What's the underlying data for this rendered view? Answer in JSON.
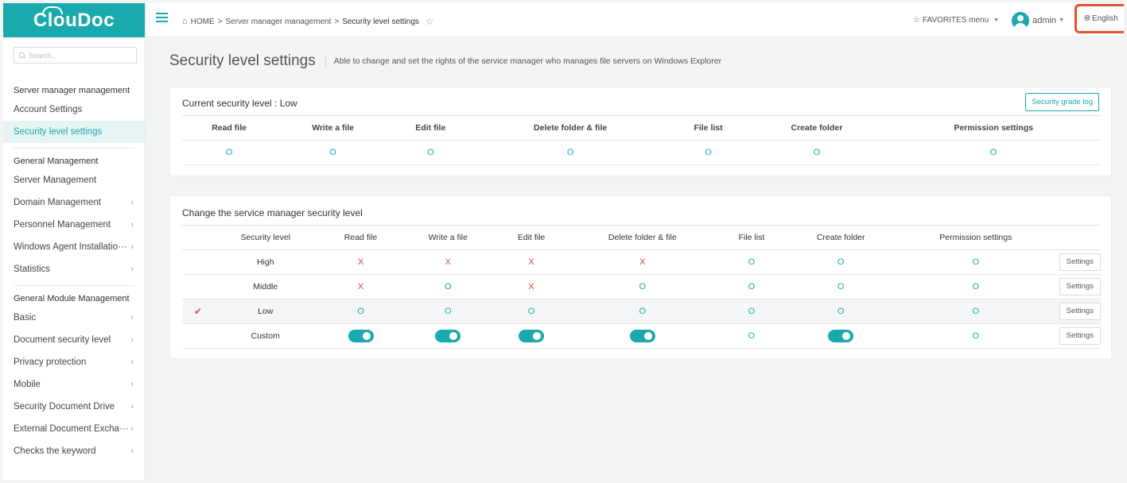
{
  "app": {
    "logo": "ClouDoc"
  },
  "search": {
    "placeholder": "Search..."
  },
  "sidebar": {
    "sections": [
      {
        "title": "Server manager management",
        "items": [
          {
            "label": "Account Settings",
            "chevron": false,
            "active": false
          },
          {
            "label": "Security level settings",
            "chevron": false,
            "active": true
          }
        ]
      },
      {
        "title": "General Management",
        "items": [
          {
            "label": "Server Management",
            "chevron": false,
            "active": false
          },
          {
            "label": "Domain Management",
            "chevron": true,
            "active": false
          },
          {
            "label": "Personnel Management",
            "chevron": true,
            "active": false
          },
          {
            "label": "Windows Agent Installatio···",
            "chevron": true,
            "active": false
          },
          {
            "label": "Statistics",
            "chevron": true,
            "active": false
          }
        ]
      },
      {
        "title": "General Module Management",
        "items": [
          {
            "label": "Basic",
            "chevron": true,
            "active": false
          },
          {
            "label": "Document security level",
            "chevron": true,
            "active": false
          },
          {
            "label": "Privacy protection",
            "chevron": true,
            "active": false
          },
          {
            "label": "Mobile",
            "chevron": true,
            "active": false
          },
          {
            "label": "Security Document Drive",
            "chevron": true,
            "active": false
          },
          {
            "label": "External Document Excha···",
            "chevron": true,
            "active": false
          },
          {
            "label": "Checks the keyword",
            "chevron": true,
            "active": false
          }
        ]
      }
    ]
  },
  "header": {
    "breadcrumb": {
      "home": "HOME",
      "sep": ">",
      "parent": "Server manager management",
      "current": "Security level settings"
    },
    "favorites": "FAVORITES menu",
    "user": "admin",
    "language": "English"
  },
  "page": {
    "title": "Security level settings",
    "description": "Able to change and set the rights of the service manager who manages file servers on Windows Explorer"
  },
  "current_panel": {
    "title": "Current security level : Low",
    "grade_log_button": "Security grade log",
    "columns": [
      "Read file",
      "Write a file",
      "Edit file",
      "Delete folder & file",
      "File list",
      "Create folder",
      "Permission settings"
    ],
    "values": [
      "O",
      "O",
      "O",
      "O",
      "O",
      "O",
      "O"
    ]
  },
  "change_panel": {
    "title": "Change the service manager security level",
    "columns": [
      "Security level",
      "Read file",
      "Write a file",
      "Edit file",
      "Delete folder & file",
      "File list",
      "Create folder",
      "Permission settings"
    ],
    "settings_label": "Settings",
    "rows": [
      {
        "level": "High",
        "selected": false,
        "cells": [
          "X",
          "X",
          "X",
          "X",
          "O",
          "O",
          "O"
        ]
      },
      {
        "level": "Middle",
        "selected": false,
        "cells": [
          "X",
          "O",
          "X",
          "O",
          "O",
          "O",
          "O"
        ]
      },
      {
        "level": "Low",
        "selected": true,
        "cells": [
          "O",
          "O",
          "O",
          "O",
          "O",
          "O",
          "O"
        ]
      },
      {
        "level": "Custom",
        "selected": false,
        "cells": [
          "toggle-on",
          "toggle-on",
          "toggle-on",
          "toggle-on",
          "O",
          "toggle-on",
          "O"
        ]
      }
    ]
  },
  "colors": {
    "accent": "#1aa9ac",
    "deny": "#e83b3b",
    "highlight_border": "#e8502f"
  }
}
